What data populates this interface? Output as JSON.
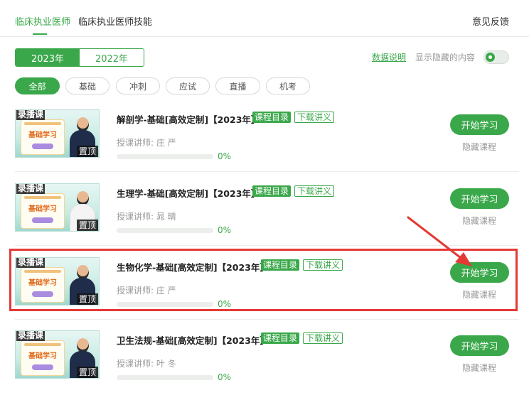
{
  "tabs": [
    {
      "label": "临床执业医师",
      "active": true
    },
    {
      "label": "临床执业医师技能",
      "active": false
    }
  ],
  "feedback_label": "意见反馈",
  "years": [
    {
      "label": "2023年",
      "active": true
    },
    {
      "label": "2022年",
      "active": false
    }
  ],
  "data_note_label": "数据说明",
  "show_hidden_label": "显示隐藏的内容",
  "show_hidden_on": true,
  "filters": [
    {
      "label": "全部",
      "active": true
    },
    {
      "label": "基础",
      "active": false
    },
    {
      "label": "冲刺",
      "active": false
    },
    {
      "label": "应试",
      "active": false
    },
    {
      "label": "直播",
      "active": false
    },
    {
      "label": "机考",
      "active": false
    }
  ],
  "courses": [
    {
      "badge": "录播课",
      "pin": "置顶",
      "thumb_title": "基础学习",
      "title": "解剖学-基础[高效定制]【2023年】",
      "catalog_label": "课程目录",
      "handout_label": "下载讲义",
      "teacher": "授课讲师:  庄    严",
      "progress": 0,
      "progress_text": "0%",
      "study_label": "开始学习",
      "hide_label": "隐藏课程",
      "highlighted": false
    },
    {
      "badge": "录播课",
      "pin": "置顶",
      "thumb_title": "基础学习",
      "title": "生理学-基础[高效定制]【2023年】",
      "catalog_label": "课程目录",
      "handout_label": "下载讲义",
      "teacher": "授课讲师:  晁    晴",
      "progress": 0,
      "progress_text": "0%",
      "study_label": "开始学习",
      "hide_label": "隐藏课程",
      "highlighted": false
    },
    {
      "badge": "录播课",
      "pin": "置顶",
      "thumb_title": "基础学习",
      "title": "生物化学-基础[高效定制]【2023年】",
      "catalog_label": "课程目录",
      "handout_label": "下载讲义",
      "teacher": "授课讲师:  庄    严",
      "progress": 0,
      "progress_text": "0%",
      "study_label": "开始学习",
      "hide_label": "隐藏课程",
      "highlighted": true
    },
    {
      "badge": "录播课",
      "pin": "置顶",
      "thumb_title": "基础学习",
      "title": "卫生法规-基础[高效定制]【2023年】",
      "catalog_label": "课程目录",
      "handout_label": "下载讲义",
      "teacher": "授课讲师:  叶    冬",
      "progress": 0,
      "progress_text": "0%",
      "study_label": "开始学习",
      "hide_label": "隐藏课程",
      "highlighted": false
    }
  ],
  "colors": {
    "accent": "#3aa84a",
    "annotation": "#e53935"
  }
}
